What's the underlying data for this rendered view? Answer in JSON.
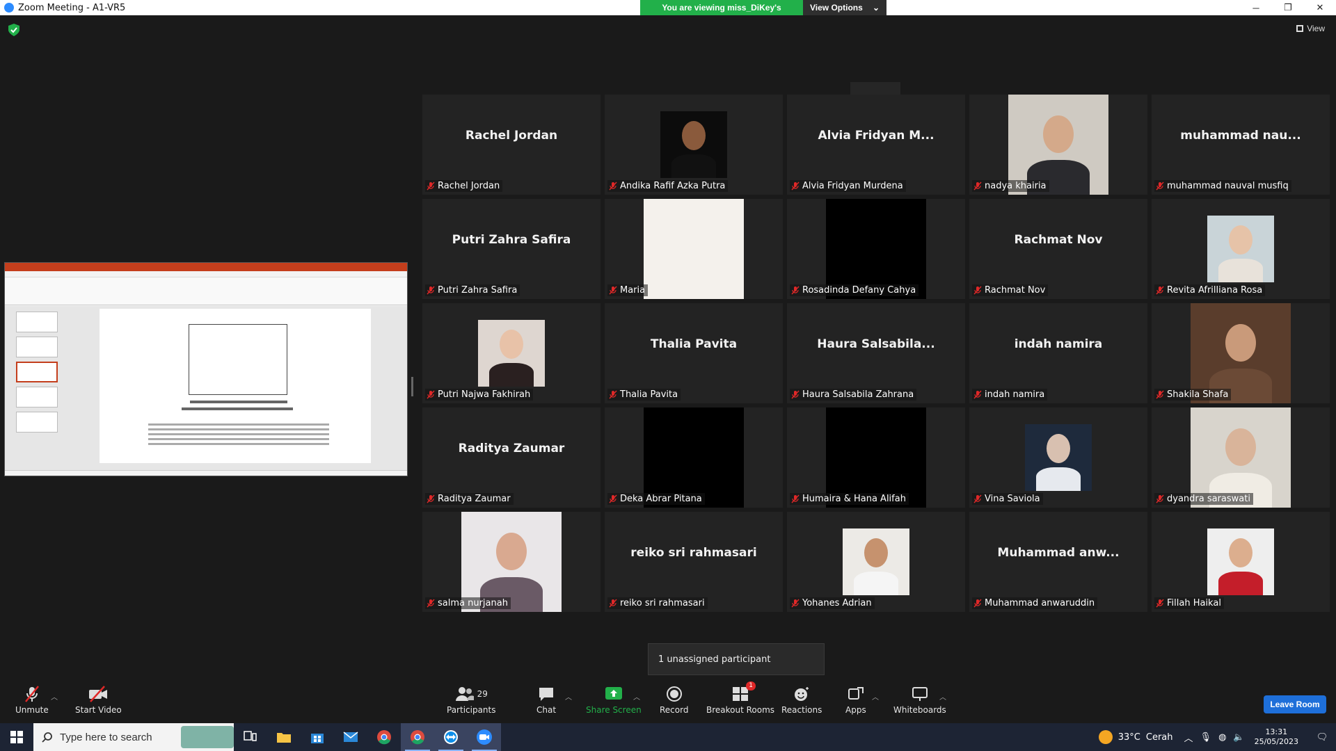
{
  "window": {
    "title": "Zoom Meeting - A1-VR5"
  },
  "banner": {
    "message": "You are viewing miss_DiKey's screen",
    "options_label": "View Options"
  },
  "view_button": {
    "label": "View"
  },
  "gallery": {
    "tiles": [
      {
        "name": "Rachel Jordan",
        "display": "Rachel Jordan",
        "video": false
      },
      {
        "name": "Andika Rafif Azka Putra",
        "display": "",
        "video": true,
        "bg": "#0c0c0c",
        "skin": "#8a5a3c",
        "shirt": "#111111",
        "shape": "sq"
      },
      {
        "name": "Alvia Fridyan Murdena",
        "display": "Alvia Fridyan M...",
        "video": false
      },
      {
        "name": "nadya khairia",
        "display": "",
        "video": true,
        "bg": "#cfcac2",
        "skin": "#d4a98a",
        "shirt": "#2a2a2e",
        "shape": "tall"
      },
      {
        "name": "muhammad nauval musfiq",
        "display": "muhammad  nau...",
        "video": false
      },
      {
        "name": "Putri Zahra Safira",
        "display": "Putri Zahra Safira",
        "video": false
      },
      {
        "name": "Maria",
        "display": "",
        "video": true,
        "bg": "#f4f1ec",
        "skin": "",
        "shirt": "",
        "shape": "tall"
      },
      {
        "name": "Rosadinda Defany Cahya",
        "display": "",
        "video": true,
        "bg": "#000000",
        "skin": "",
        "shirt": "",
        "shape": "tall"
      },
      {
        "name": "Rachmat Nov",
        "display": "Rachmat Nov",
        "video": false
      },
      {
        "name": "Revita Afrilliana Rosa",
        "display": "",
        "video": true,
        "bg": "#c9d4d8",
        "skin": "#e6c3a8",
        "shirt": "#e8e2da",
        "shape": "sq"
      },
      {
        "name": "Putri Najwa Fakhirah",
        "display": "",
        "video": true,
        "bg": "#ded6d0",
        "skin": "#e8c2a8",
        "shirt": "#2a2020",
        "shape": "sq"
      },
      {
        "name": "Thalia Pavita",
        "display": "Thalia Pavita",
        "video": false
      },
      {
        "name": "Haura Salsabila Zahrana",
        "display": "Haura  Salsabila...",
        "video": false
      },
      {
        "name": "indah namira",
        "display": "indah namira",
        "video": false
      },
      {
        "name": "Shakila Shafa",
        "display": "",
        "video": true,
        "bg": "#5a3d2c",
        "skin": "#c99a7a",
        "shirt": "#6b4a36",
        "shape": "tall"
      },
      {
        "name": "Raditya Zaumar",
        "display": "Raditya Zaumar",
        "video": false
      },
      {
        "name": "Deka Abrar Pitana",
        "display": "",
        "video": true,
        "bg": "#000000",
        "skin": "",
        "shirt": "",
        "shape": "tall"
      },
      {
        "name": "Humaira & Hana Alifah",
        "display": "",
        "video": true,
        "bg": "#000000",
        "skin": "",
        "shirt": "",
        "shape": "tall"
      },
      {
        "name": "Vina Saviola",
        "display": "",
        "video": true,
        "bg": "#1e2a3c",
        "skin": "#d8c0b0",
        "shirt": "#e6e9ee",
        "shape": "sq"
      },
      {
        "name": "dyandra saraswati",
        "display": "",
        "video": true,
        "bg": "#d8d4cc",
        "skin": "#d9b49a",
        "shirt": "#f0ece4",
        "shape": "tall"
      },
      {
        "name": "salma nurjanah",
        "display": "",
        "video": true,
        "bg": "#e9e6e8",
        "skin": "#d9a990",
        "shirt": "#6a5a66",
        "shape": "tall"
      },
      {
        "name": "reiko sri rahmasari",
        "display": "reiko sri rahmasari",
        "video": false
      },
      {
        "name": "Yohanes Adrian",
        "display": "",
        "video": true,
        "bg": "#eceae6",
        "skin": "#c6926e",
        "shirt": "#f5f5f5",
        "shape": "sq"
      },
      {
        "name": "Muhammad anwaruddin",
        "display": "Muhammad  anw...",
        "video": false
      },
      {
        "name": "Fillah Haikal",
        "display": "",
        "video": true,
        "bg": "#eeeeee",
        "skin": "#dcae8e",
        "shirt": "#c41e2a",
        "shape": "sq"
      }
    ]
  },
  "notice": {
    "text": "1 unassigned participant"
  },
  "toolbar": {
    "unmute": "Unmute",
    "start_video": "Start Video",
    "participants": "Participants",
    "participants_count": "29",
    "chat": "Chat",
    "share_screen": "Share Screen",
    "record": "Record",
    "breakout_rooms": "Breakout Rooms",
    "breakout_badge": "1",
    "reactions": "Reactions",
    "apps": "Apps",
    "whiteboards": "Whiteboards",
    "leave": "Leave Room"
  },
  "taskbar": {
    "search_placeholder": "Type here to search",
    "weather_temp": "33°C",
    "weather_desc": "Cerah",
    "time": "13:31",
    "date": "25/05/2023"
  },
  "colors": {
    "accent_green": "#22b04a",
    "leave_blue": "#1e6fd9",
    "muted_red": "#e02828",
    "tile_bg": "#232323"
  }
}
